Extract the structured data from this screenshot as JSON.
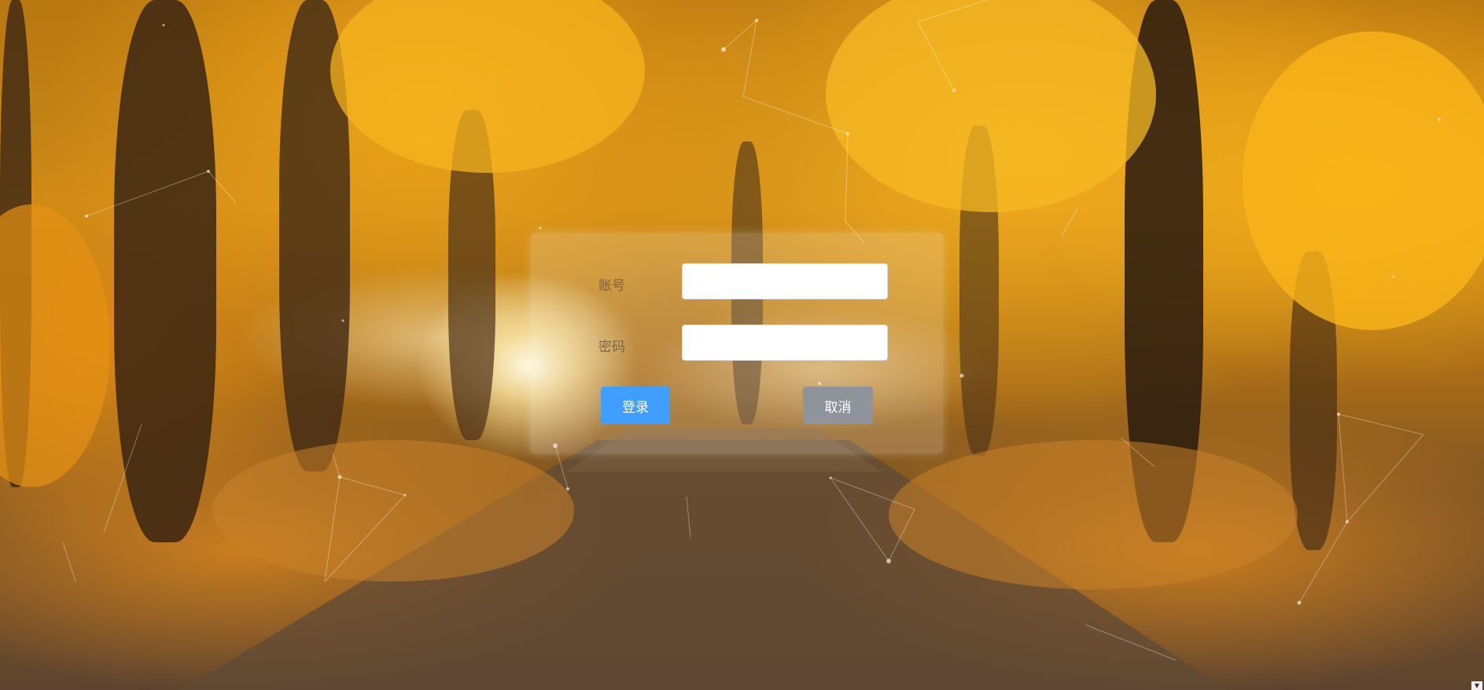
{
  "login": {
    "username_label": "账号",
    "username_value": "",
    "password_label": "密码",
    "password_value": "",
    "login_button": "登录",
    "cancel_button": "取消"
  },
  "colors": {
    "login_button": "#409eff",
    "cancel_button": "#8e939c"
  }
}
